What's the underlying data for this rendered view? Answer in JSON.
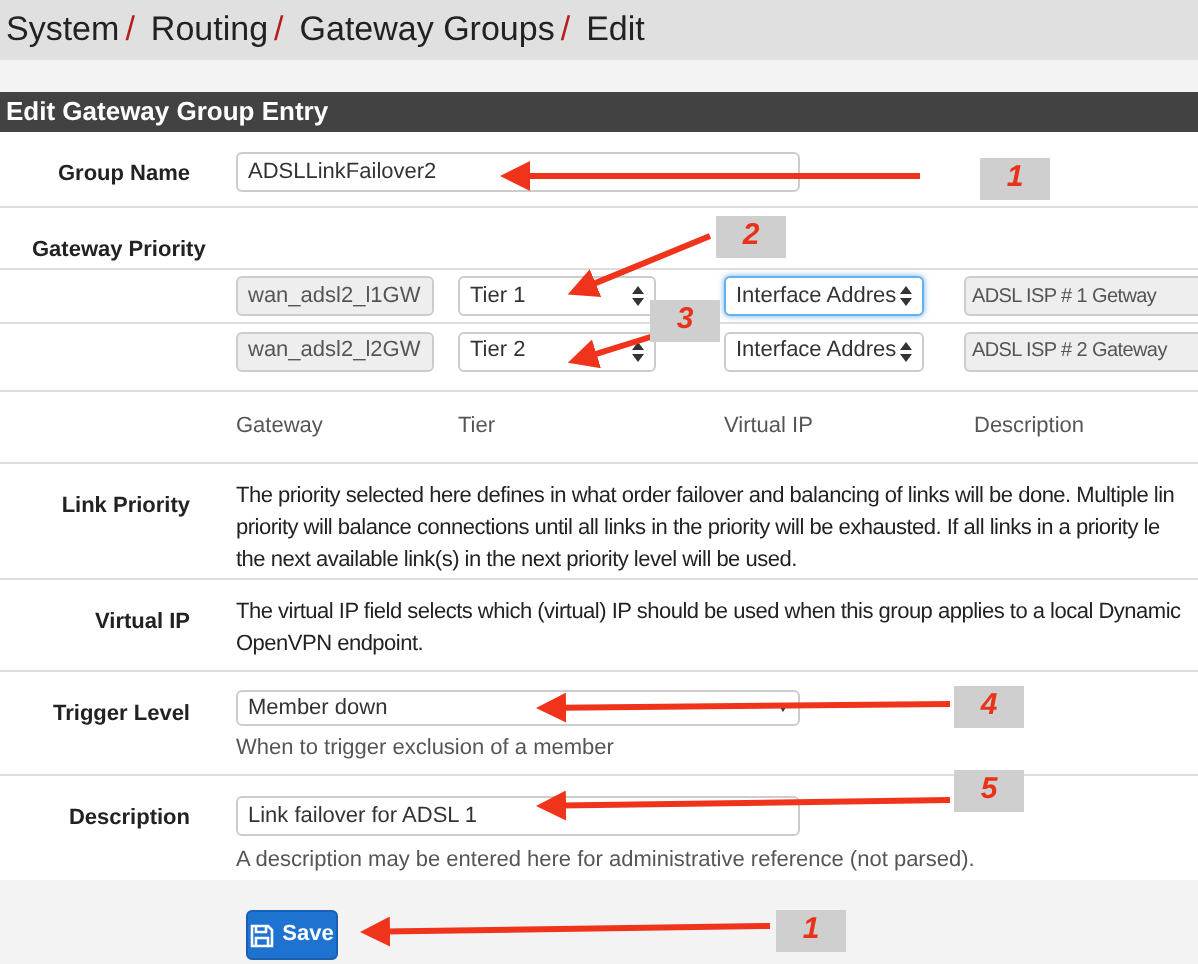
{
  "breadcrumb": [
    "System",
    "Routing",
    "Gateway Groups",
    "Edit"
  ],
  "breadcrumb_separator": "/",
  "panel_title": "Edit Gateway Group Entry",
  "group_name": {
    "label": "Group Name",
    "value": "ADSLLinkFailover2"
  },
  "gateway_priority": {
    "label": "Gateway Priority",
    "rows": [
      {
        "gateway": "wan_adsl2_l1GW",
        "tier": "Tier 1",
        "virtual_ip": "Interface Addres",
        "virtual_ip_focused": true,
        "description": "ADSL ISP # 1 Getway"
      },
      {
        "gateway": "wan_adsl2_l2GW",
        "tier": "Tier 2",
        "virtual_ip": "Interface Addres",
        "virtual_ip_focused": false,
        "description": "ADSL ISP # 2 Gateway"
      }
    ],
    "columns": [
      "Gateway",
      "Tier",
      "Virtual IP",
      "Description"
    ]
  },
  "link_priority": {
    "label": "Link Priority",
    "lines": [
      "The priority selected here defines in what order failover and balancing of links will be done. Multiple lin",
      "priority will balance connections until all links in the priority will be exhausted. If all links in a priority le",
      "the next available link(s) in the next priority level will be used."
    ]
  },
  "virtual_ip": {
    "label": "Virtual IP",
    "lines": [
      "The virtual IP field selects which (virtual) IP should be used when this group applies to a local Dynamic",
      "OpenVPN endpoint."
    ]
  },
  "trigger_level": {
    "label": "Trigger Level",
    "value": "Member down",
    "help": "When to trigger exclusion of a member"
  },
  "description": {
    "label": "Description",
    "value": "Link failover for ADSL 1",
    "help": "A description may be entered here for administrative reference (not parsed)."
  },
  "save_button": "Save",
  "annotations": [
    "1",
    "2",
    "3",
    "4",
    "5",
    "1"
  ]
}
